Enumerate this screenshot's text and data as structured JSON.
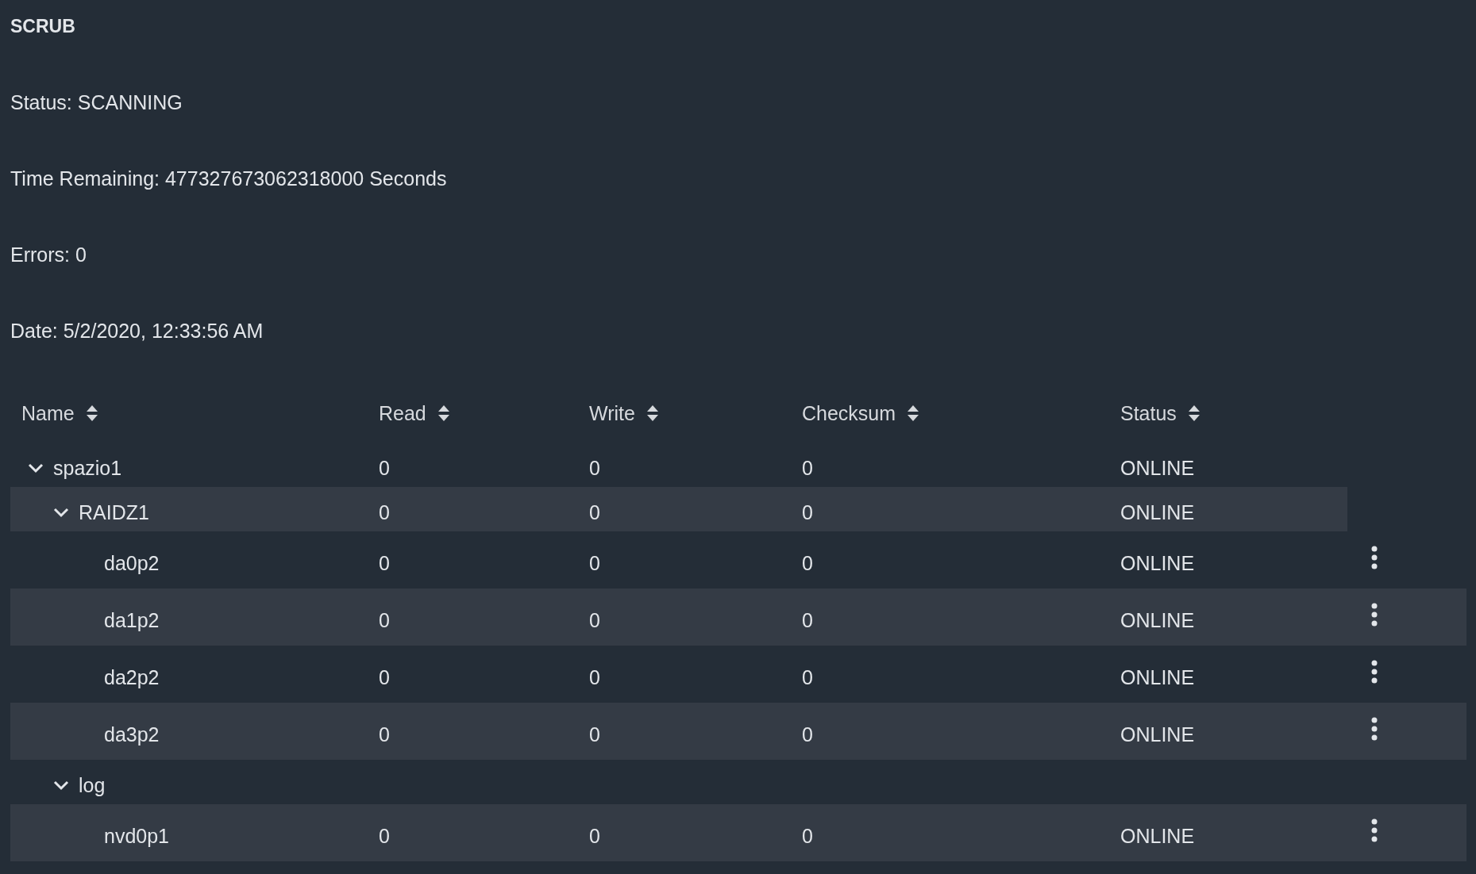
{
  "scrub": {
    "title": "SCRUB",
    "lines": [
      "Status: SCANNING",
      "Time Remaining: 477327673062318000 Seconds",
      "Errors: 0",
      "Date: 5/2/2020, 12:33:56 AM"
    ]
  },
  "table": {
    "columns": [
      {
        "label": "Name"
      },
      {
        "label": "Read"
      },
      {
        "label": "Write"
      },
      {
        "label": "Checksum"
      },
      {
        "label": "Status"
      }
    ],
    "rows": [
      {
        "kind": "group",
        "name": "spazio1",
        "read": "0",
        "write": "0",
        "checksum": "0",
        "status": "ONLINE",
        "expanded": true,
        "children": [
          {
            "kind": "group",
            "name": "RAIDZ1",
            "read": "0",
            "write": "0",
            "checksum": "0",
            "status": "ONLINE",
            "expanded": true,
            "children": [
              {
                "kind": "device",
                "name": "da0p2",
                "read": "0",
                "write": "0",
                "checksum": "0",
                "status": "ONLINE"
              },
              {
                "kind": "device",
                "name": "da1p2",
                "read": "0",
                "write": "0",
                "checksum": "0",
                "status": "ONLINE"
              },
              {
                "kind": "device",
                "name": "da2p2",
                "read": "0",
                "write": "0",
                "checksum": "0",
                "status": "ONLINE"
              },
              {
                "kind": "device",
                "name": "da3p2",
                "read": "0",
                "write": "0",
                "checksum": "0",
                "status": "ONLINE"
              }
            ]
          },
          {
            "kind": "group",
            "name": "log",
            "expanded": true,
            "children": [
              {
                "kind": "device",
                "name": "nvd0p1",
                "read": "0",
                "write": "0",
                "checksum": "0",
                "status": "ONLINE"
              }
            ]
          }
        ]
      }
    ]
  }
}
